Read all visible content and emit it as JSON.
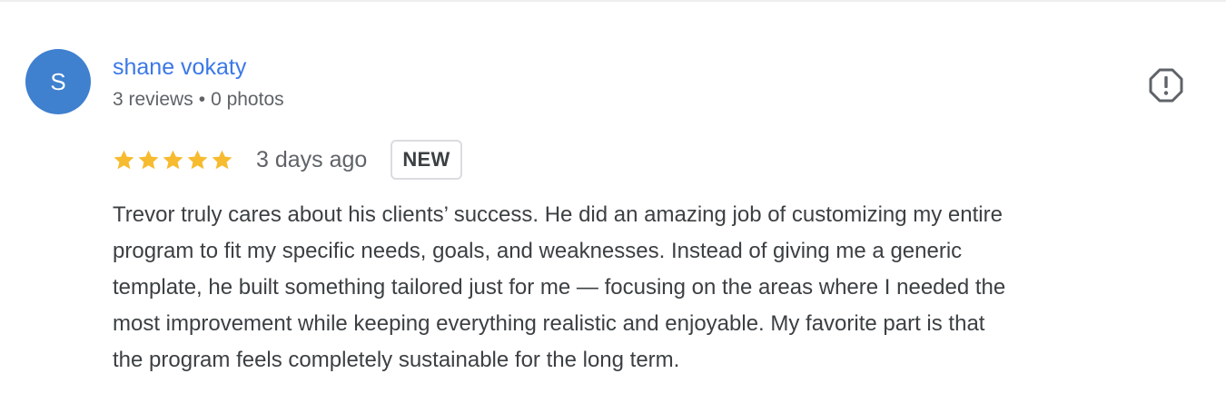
{
  "reviewer": {
    "initial": "S",
    "name": "shane vokaty",
    "reviews_count": "3 reviews",
    "separator": "•",
    "photos_count": "0 photos",
    "avatar_color": "#3f80cf",
    "name_color": "#3b78e7"
  },
  "flag_button": {
    "icon": "report-flag-icon"
  },
  "rating": {
    "stars": 5,
    "max_stars": 5,
    "star_color": "#f6bb2e",
    "date": "3 days ago",
    "badge": "NEW"
  },
  "review": {
    "lines": [
      "Trevor truly cares about his clients’ success. He did an amazing job of customizing my entire",
      "program to fit my specific needs, goals, and weaknesses. Instead of giving me a generic",
      "template, he built something tailored just for me — focusing on the areas where I needed the",
      "most improvement while keeping everything realistic and enjoyable. My favorite part is that",
      "the program feels completely sustainable for the long term."
    ]
  }
}
